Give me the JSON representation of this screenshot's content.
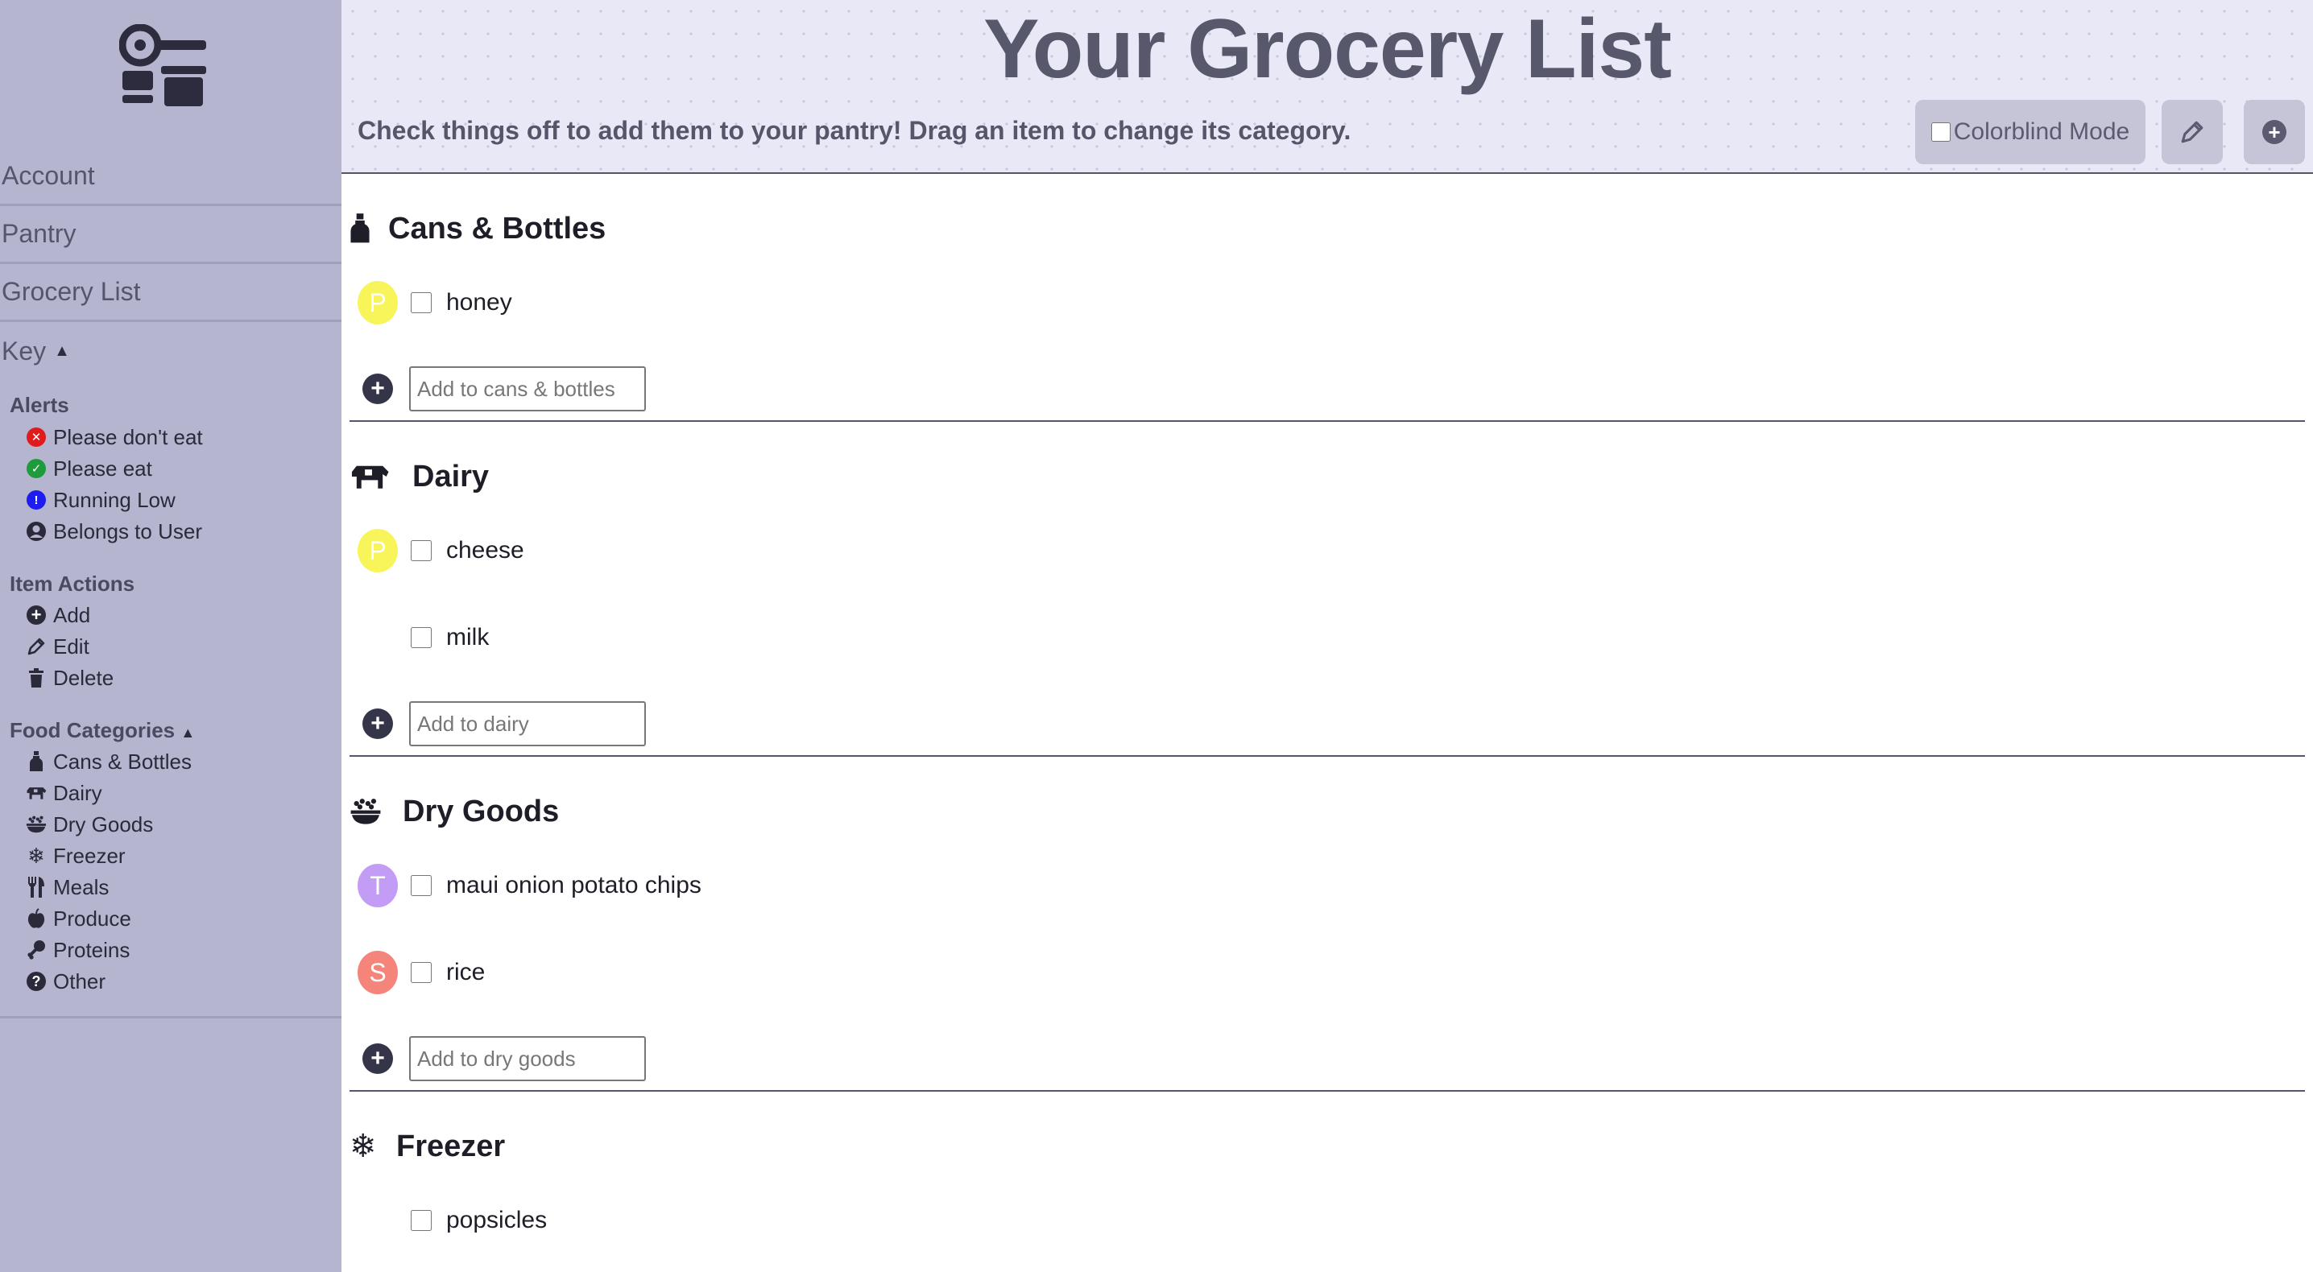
{
  "sidebar": {
    "nav": {
      "account": "Account",
      "pantry": "Pantry",
      "grocery_list": "Grocery List",
      "key": "Key",
      "key_caret": "▲"
    },
    "key": {
      "alerts_title": "Alerts",
      "alerts": [
        {
          "label": "Please don't eat",
          "icon": "x-circle-icon",
          "color": "#e01b1b"
        },
        {
          "label": "Please eat",
          "icon": "check-circle-icon",
          "color": "#1e9b3a"
        },
        {
          "label": "Running Low",
          "icon": "exclamation-circle-icon",
          "color": "#1d1df0"
        },
        {
          "label": "Belongs to User",
          "icon": "user-circle-icon",
          "color": "#2a2a3a"
        }
      ],
      "actions_title": "Item Actions",
      "actions": [
        {
          "label": "Add",
          "icon": "plus-circle-icon"
        },
        {
          "label": "Edit",
          "icon": "pencil-icon"
        },
        {
          "label": "Delete",
          "icon": "trash-icon"
        }
      ],
      "categories_title": "Food Categories",
      "categories_caret": "▲",
      "categories": [
        {
          "label": "Cans & Bottles",
          "icon": "bottle-icon"
        },
        {
          "label": "Dairy",
          "icon": "cow-icon"
        },
        {
          "label": "Dry Goods",
          "icon": "bowl-icon"
        },
        {
          "label": "Freezer",
          "icon": "snowflake-icon"
        },
        {
          "label": "Meals",
          "icon": "utensils-icon"
        },
        {
          "label": "Produce",
          "icon": "apple-icon"
        },
        {
          "label": "Proteins",
          "icon": "drumstick-icon"
        },
        {
          "label": "Other",
          "icon": "question-circle-icon"
        }
      ]
    }
  },
  "header": {
    "title": "Your Grocery List",
    "subtitle": "Check things off to add them to your pantry! Drag an item to change its category.",
    "colorblind_label": "Colorblind Mode",
    "colorblind_checked": false
  },
  "categories": [
    {
      "name": "Cans & Bottles",
      "icon": "bottle-icon",
      "items": [
        {
          "name": "honey",
          "avatar": "P",
          "avatar_color": "#f8f55a",
          "checked": false
        }
      ],
      "add_placeholder": "Add to cans & bottles"
    },
    {
      "name": "Dairy",
      "icon": "cow-icon",
      "items": [
        {
          "name": "cheese",
          "avatar": "P",
          "avatar_color": "#f8f55a",
          "checked": false
        },
        {
          "name": "milk",
          "avatar": "",
          "avatar_color": "",
          "checked": false
        }
      ],
      "add_placeholder": "Add to dairy"
    },
    {
      "name": "Dry Goods",
      "icon": "bowl-icon",
      "items": [
        {
          "name": "maui onion potato chips",
          "avatar": "T",
          "avatar_color": "#c39df5",
          "checked": false
        },
        {
          "name": "rice",
          "avatar": "S",
          "avatar_color": "#f5847a",
          "checked": false
        }
      ],
      "add_placeholder": "Add to dry goods"
    },
    {
      "name": "Freezer",
      "icon": "snowflake-icon",
      "items": [
        {
          "name": "popsicles",
          "avatar": "",
          "avatar_color": "",
          "checked": false
        }
      ]
    }
  ]
}
